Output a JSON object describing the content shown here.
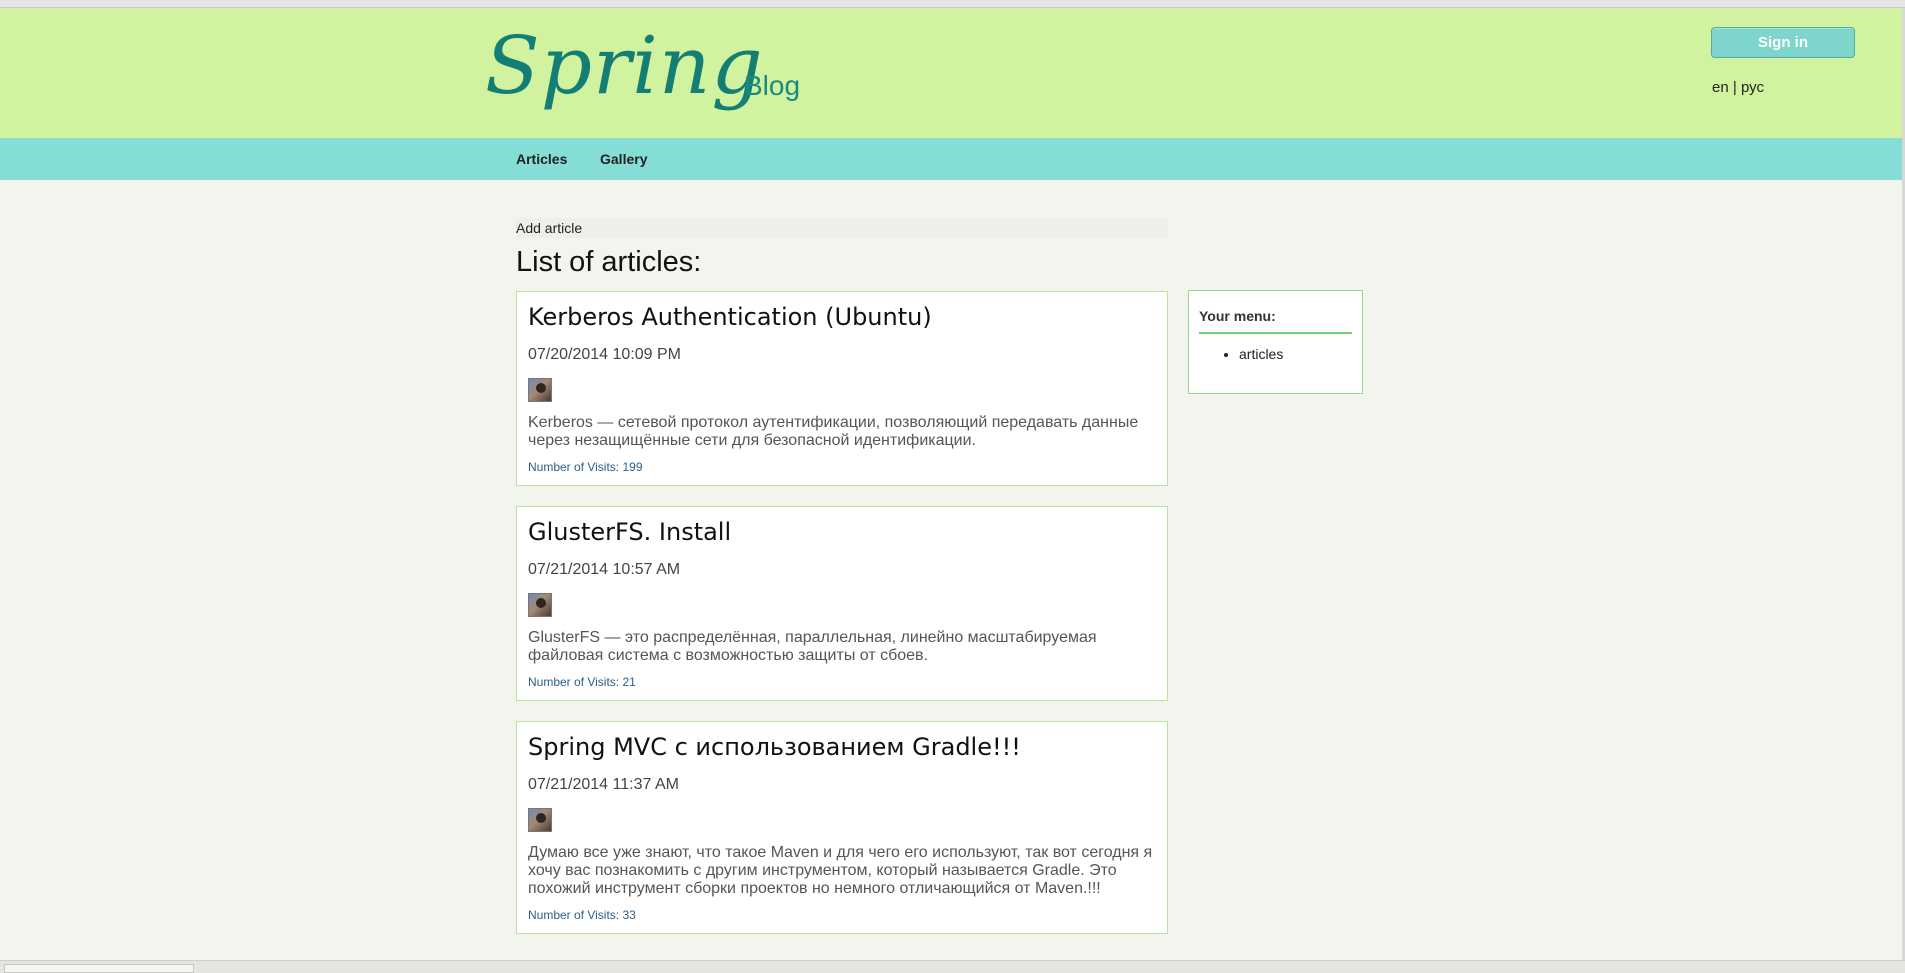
{
  "header": {
    "logo": "Spring",
    "logo_sub": "Blog",
    "signin_label": "Sign in",
    "lang_en": "en",
    "lang_sep": "|",
    "lang_ru": "рус"
  },
  "nav": {
    "items": [
      {
        "label": "Articles"
      },
      {
        "label": "Gallery"
      }
    ]
  },
  "main": {
    "add_article": "Add article",
    "list_title": "List of articles:",
    "articles": [
      {
        "title": "Kerberos Authentication (Ubuntu)",
        "date": "07/20/2014 10:09 PM",
        "text": "Kerberos — сетевой протокол аутентификации, позволяющий передавать данные через незащищённые сети для безопасной идентификации.",
        "visits": "Number of Visits: 199"
      },
      {
        "title": "GlusterFS. Install",
        "date": "07/21/2014 10:57 AM",
        "text": "GlusterFS — это распределённая, параллельная, линейно масштабируемая файловая система с возможностью защиты от сбоев.",
        "visits": "Number of Visits: 21"
      },
      {
        "title": "Spring MVC с использованием Gradle!!!",
        "date": "07/21/2014 11:37 AM",
        "text": "Думаю все уже знают, что такое Maven и для чего его используют, так вот сегодня я хочу вас познакомить с другим инструментом, который называется Gradle. Это похожий инструмент сборки проектов но немного отличающийся от Maven.!!!",
        "visits": "Number of Visits: 33"
      }
    ]
  },
  "sidebar": {
    "title": "Your menu:",
    "items": [
      {
        "label": "articles"
      }
    ]
  },
  "colors": {
    "header_bg": "#d1f29f",
    "nav_bg": "#84ded5",
    "brand": "#137f74",
    "button": "#7dd5cc"
  }
}
